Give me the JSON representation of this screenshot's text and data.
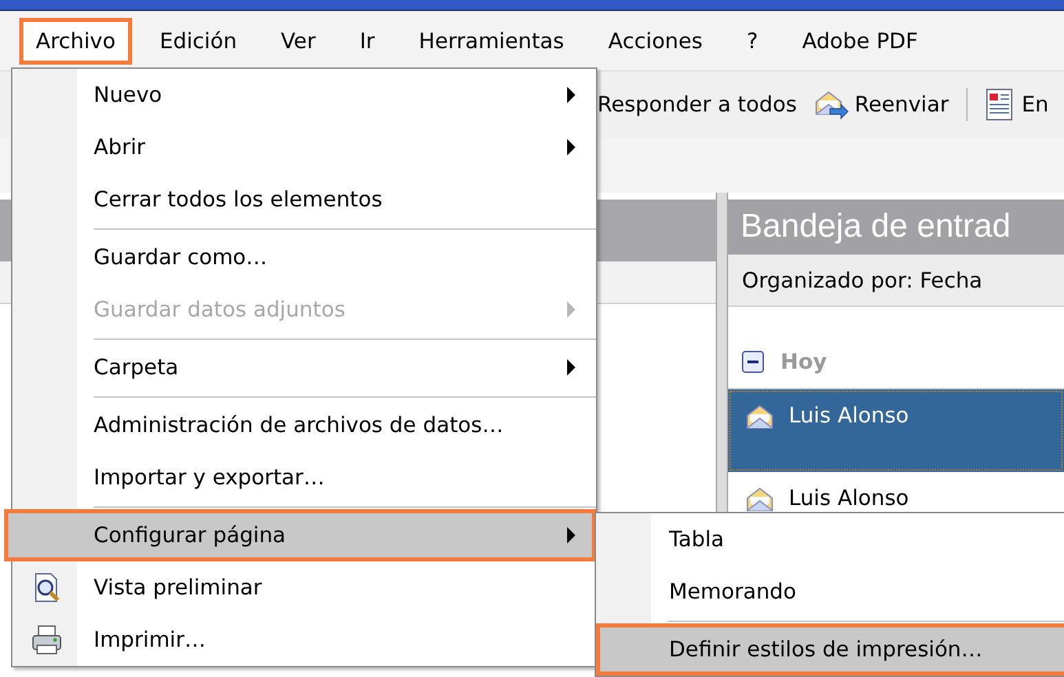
{
  "menu_bar": [
    {
      "label": "Archivo",
      "selected": true,
      "callout": true
    },
    {
      "label": "Edición",
      "selected": false,
      "callout": false
    },
    {
      "label": "Ver",
      "selected": false,
      "callout": false
    },
    {
      "label": "Ir",
      "selected": false,
      "callout": false
    },
    {
      "label": "Herramientas",
      "selected": false,
      "callout": false
    },
    {
      "label": "Acciones",
      "selected": false,
      "callout": false
    },
    {
      "label": "?",
      "selected": false,
      "callout": false
    },
    {
      "label": "Adobe PDF",
      "selected": false,
      "callout": false
    }
  ],
  "toolbar": [
    {
      "kind": "text",
      "label": "Responder a todos"
    },
    {
      "kind": "forward",
      "label": "Reenviar"
    },
    {
      "kind": "separator"
    },
    {
      "kind": "send",
      "label": "En"
    }
  ],
  "inbox": {
    "title": "Bandeja de entrad",
    "arrange_by": "Organizado por: Fecha",
    "group": {
      "label": "Hoy",
      "expanded": true
    },
    "messages": [
      {
        "sender": "Luis Alonso",
        "selected": true
      },
      {
        "sender": "Luis Alonso",
        "selected": false
      }
    ]
  },
  "file_menu": {
    "items": [
      {
        "kind": "item",
        "label": "Nuevo",
        "submenu": true,
        "disabled": false,
        "selected": false,
        "callout": false
      },
      {
        "kind": "item",
        "label": "Abrir",
        "submenu": true,
        "disabled": false,
        "selected": false,
        "callout": false
      },
      {
        "kind": "item",
        "label": "Cerrar todos los elementos",
        "submenu": false,
        "disabled": false,
        "selected": false,
        "callout": false
      },
      {
        "kind": "separator"
      },
      {
        "kind": "item",
        "label": "Guardar como…",
        "submenu": false,
        "disabled": false,
        "selected": false,
        "callout": false
      },
      {
        "kind": "item",
        "label": "Guardar datos adjuntos",
        "submenu": true,
        "disabled": true,
        "selected": false,
        "callout": false
      },
      {
        "kind": "separator"
      },
      {
        "kind": "item",
        "label": "Carpeta",
        "submenu": true,
        "disabled": false,
        "selected": false,
        "callout": false
      },
      {
        "kind": "separator"
      },
      {
        "kind": "item",
        "label": "Administración de archivos de datos…",
        "submenu": false,
        "disabled": false,
        "selected": false,
        "callout": false
      },
      {
        "kind": "item",
        "label": "Importar y exportar…",
        "submenu": false,
        "disabled": false,
        "selected": false,
        "callout": false
      },
      {
        "kind": "separator"
      },
      {
        "kind": "item",
        "label": "Configurar página",
        "submenu": true,
        "disabled": false,
        "selected": true,
        "callout": true
      },
      {
        "kind": "preview",
        "label": "Vista preliminar",
        "submenu": false,
        "disabled": false,
        "selected": false,
        "callout": false
      },
      {
        "kind": "print",
        "label": "Imprimir…",
        "submenu": false,
        "disabled": false,
        "selected": false,
        "callout": false
      }
    ]
  },
  "page_setup_menu": {
    "items": [
      {
        "kind": "item",
        "label": "Tabla",
        "selected": false,
        "callout": false
      },
      {
        "kind": "item",
        "label": "Memorando",
        "selected": false,
        "callout": false
      },
      {
        "kind": "separator"
      },
      {
        "kind": "item",
        "label": "Definir estilos de impresión…",
        "selected": true,
        "callout": true
      }
    ]
  }
}
